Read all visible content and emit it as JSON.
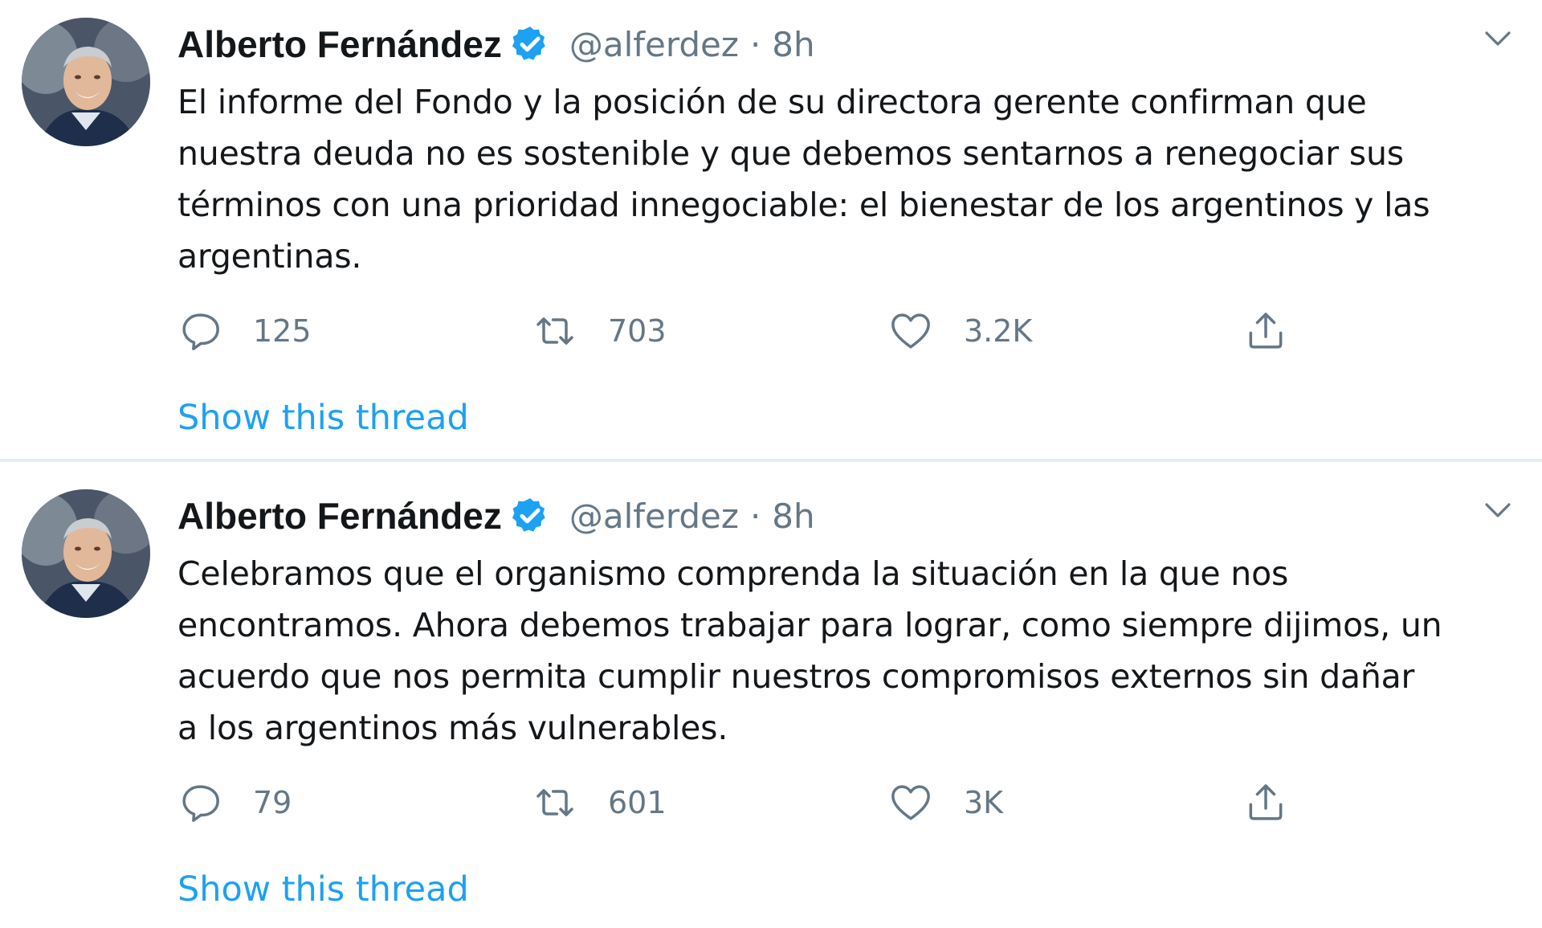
{
  "colors": {
    "text": "#14171a",
    "secondary": "#657786",
    "accent": "#1da1f2",
    "divider": "#e6ecf0"
  },
  "tweets": [
    {
      "author": {
        "name": "Alberto Fernández",
        "handle": "@alferdez",
        "verified": true
      },
      "separator": "·",
      "time": "8h",
      "text_lines": [
        "El informe del Fondo y la posición de su directora gerente confirman que",
        "nuestra deuda no es sostenible y que debemos sentarnos a renegociar sus",
        "términos con una prioridad innegociable: el bienestar de los argentinos y las",
        "argentinas."
      ],
      "replies": "125",
      "retweets": "703",
      "likes": "3.2K",
      "show_thread": "Show this thread"
    },
    {
      "author": {
        "name": "Alberto Fernández",
        "handle": "@alferdez",
        "verified": true
      },
      "separator": "·",
      "time": "8h",
      "text_lines": [
        "Celebramos que el organismo comprenda la situación en la que nos",
        "encontramos. Ahora debemos trabajar para lograr, como siempre dijimos, un",
        "acuerdo que nos permita cumplir nuestros compromisos externos sin dañar",
        "a los argentinos más vulnerables."
      ],
      "replies": "79",
      "retweets": "601",
      "likes": "3K",
      "show_thread": "Show this thread"
    }
  ],
  "icons": {
    "reply": "reply-icon",
    "retweet": "retweet-icon",
    "like": "heart-icon",
    "share": "share-icon",
    "verified": "verified-badge-icon",
    "menu": "chevron-down-icon"
  }
}
